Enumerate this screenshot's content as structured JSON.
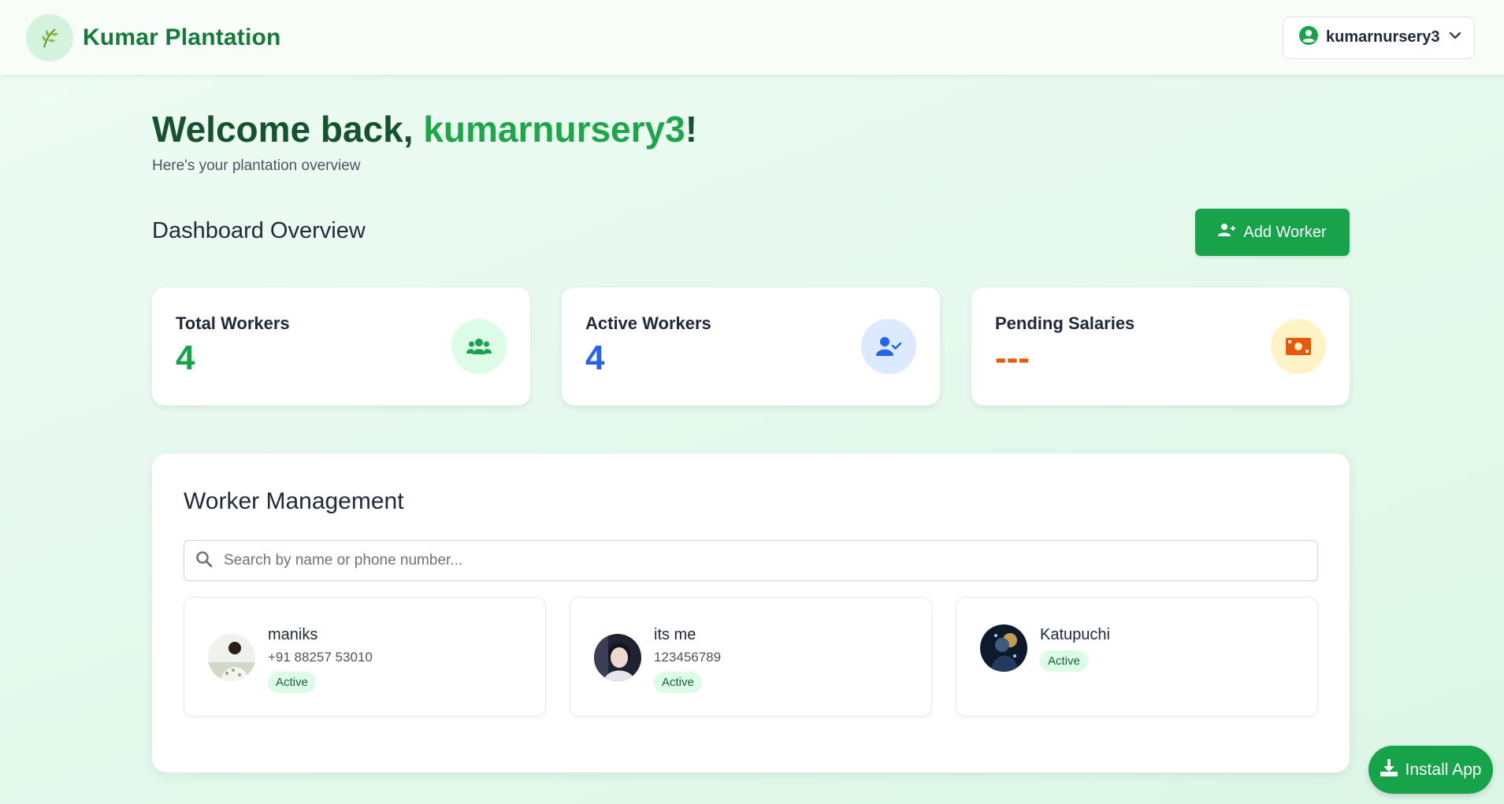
{
  "header": {
    "brand_name": "Kumar Plantation",
    "brand_icon": "leaf-icon",
    "user_menu": {
      "username": "kumarnursery3",
      "icon": "user-circle-icon",
      "chevron": "chevron-down-icon"
    }
  },
  "welcome": {
    "prefix": "Welcome back, ",
    "username": "kumarnursery3",
    "suffix": "!",
    "subtitle": "Here's your plantation overview"
  },
  "dashboard": {
    "title": "Dashboard Overview",
    "add_worker_label": "Add Worker",
    "add_worker_icon": "user-plus-icon"
  },
  "stats": [
    {
      "label": "Total Workers",
      "value": "4",
      "color": "#16a34a",
      "icon": "users-icon",
      "icon_bg": "#dcfce7"
    },
    {
      "label": "Active Workers",
      "value": "4",
      "color": "#2563eb",
      "icon": "user-check-icon",
      "icon_bg": "#dbeafe"
    },
    {
      "label": "Pending Salaries",
      "value": "---",
      "color": "#ea580c",
      "icon": "money-bill-icon",
      "icon_bg": "#fef3c7"
    }
  ],
  "worker_management": {
    "title": "Worker Management",
    "search_placeholder": "Search by name or phone number...",
    "workers": [
      {
        "name": "maniks",
        "phone": "+91 88257 53010",
        "status": "Active"
      },
      {
        "name": "its me",
        "phone": "123456789",
        "status": "Active"
      },
      {
        "name": "Katupuchi",
        "phone": "",
        "status": "Active"
      }
    ]
  },
  "install_app_label": "Install App",
  "colors": {
    "primary": "#16a34a",
    "brand": "#157a3a",
    "accent_name": "#1ea64b"
  }
}
